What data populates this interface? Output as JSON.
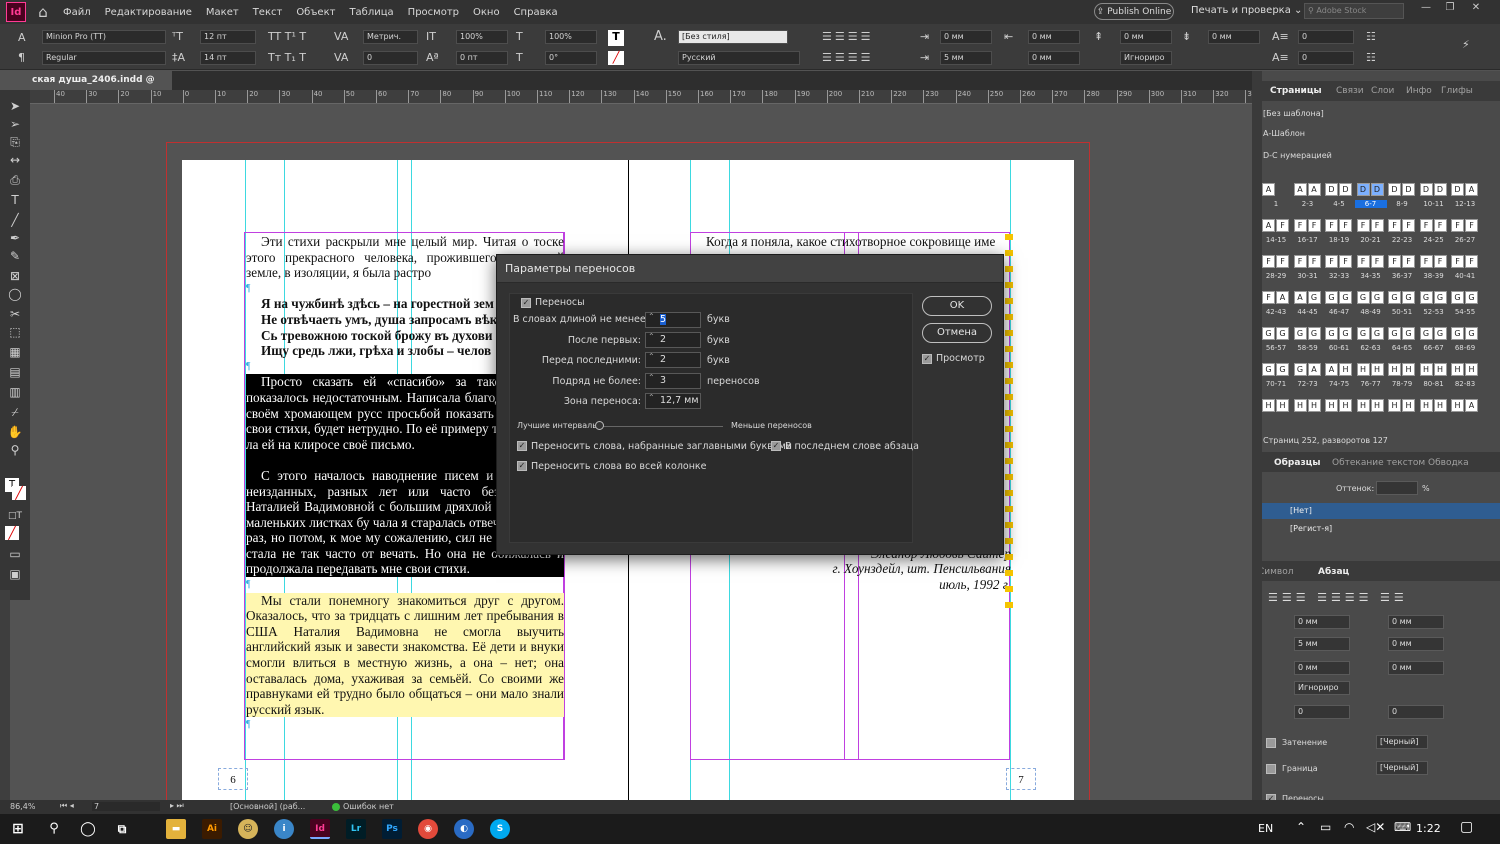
{
  "menubar": {
    "app_icon": "Id",
    "items": [
      "Файл",
      "Редактирование",
      "Макет",
      "Текст",
      "Объект",
      "Таблица",
      "Просмотр",
      "Окно",
      "Справка"
    ],
    "publish_label": "Publish Online",
    "print_review": "Печать и проверка",
    "stock_placeholder": "Adobe Stock"
  },
  "control": {
    "font_family": "Minion Pro (TT)",
    "font_style": "Regular",
    "size": "12 пт",
    "leading": "14 пт",
    "kerning": "Метрич.",
    "tracking": "0",
    "vscale": "100%",
    "hscale": "100%",
    "baseline": "0 пт",
    "skew": "0°",
    "char_style": "[Без стиля]",
    "language": "Русский",
    "indent_left": "0 мм",
    "indent_first": "5 мм",
    "indent_right": "0 мм",
    "indent_last": "0 мм",
    "space_before": "0 мм",
    "space_after": "0 мм",
    "drop_lines": "0",
    "drop_chars": "0",
    "grid_align": "Игнориро"
  },
  "doc_tab": {
    "title": "ская душа_2406.indd @ 86%"
  },
  "ruler_ticks": [
    "40",
    "30",
    "20",
    "10",
    "0",
    "10",
    "20",
    "30",
    "40",
    "50",
    "60",
    "70",
    "80",
    "90",
    "100",
    "110",
    "120",
    "130",
    "140",
    "150",
    "160",
    "170",
    "180",
    "190",
    "200",
    "210",
    "220",
    "230",
    "240",
    "250",
    "260",
    "270",
    "280",
    "290",
    "300",
    "310",
    "320",
    "330"
  ],
  "left_page": {
    "p1": "Эти стихи раскрыли мне целый мир. Читая о тоске этого прекрасного человека, прожившего на чужой земле, в изоляции, я была растро",
    "verse": [
      "Я на чужбинѣ здѣсь – на горестной зем",
      "Не отвѣчаеть умъ, душа запросамъ вѣк",
      "Сь тревожною тоской брожу въ духови",
      "Ищу средь лжи, грѣха и злобы – челов"
    ],
    "p2": "Просто сказать ей «спасибо» за такой по мне показалось недостаточным. Написала благодарности на своём хромающем русс просьбой показать мне другие свои стихи, будет нетрудно. По её примеру тихо и незам ла ей на клиросе своё письмо.",
    "p3": "С этого началось наводнение писем и сти ных и неизданных, разных лет или часто без чатанных Наталией Вадимовной с большим дряхлой машинке на маленьких листках бу чала я старалась отвечать каждый раз, но потом, к мое му сожалению, сил не хватало, и я стала не так часто от вечать. Но она не обижалась и продолжала передавать мне свои стихи.",
    "p4": "Мы стали понемногу знакомиться друг с другом. Оказалось, что за тридцать с лишним лет пребывания в США Наталия Вадимовна не смогла выучить английский язык и завести знакомства. Её дети и внуки смогли влиться в местную жизнь, а она – нет; она оставалась дома, ухаживая за семьёй. Со своими же правнуками ей трудно было общаться – они мало знали русский язык.",
    "folio": "6"
  },
  "right_page": {
    "p1": "Когда я поняла, какое стихотворное сокровище име",
    "sig": [
      "Элеанор Любовь Сайтер",
      "г. Хоунздейл, шт. Пенсильвания",
      "июль, 1992 г."
    ],
    "folio": "7"
  },
  "dialog": {
    "title": "Параметры переносов",
    "hyphenate": "Переносы",
    "words_min_label": "В словах длиной не менее:",
    "words_min": "5",
    "unit_letters": "букв",
    "after_first_label": "После первых:",
    "after_first": "2",
    "before_last_label": "Перед последними:",
    "before_last": "2",
    "limit_label": "Подряд не более:",
    "limit": "3",
    "limit_unit": "переносов",
    "zone_label": "Зона переноса:",
    "zone": "12,7 мм",
    "slider_left": "Лучшие интервалы",
    "slider_right": "Меньше переносов",
    "slider_value": 0.0,
    "caps": "Переносить слова, набранные заглавными буквами",
    "last_word": "В последнем слове абзаца",
    "across_column": "Переносить слова во всей колонке",
    "ok": "OK",
    "cancel": "Отмена",
    "preview": "Просмотр"
  },
  "panel": {
    "tabs": [
      "Страницы",
      "Связи",
      "Слои",
      "Инфо",
      "Глифы"
    ],
    "masters": [
      "[Без шаблона]",
      "А-Шаблон",
      "D-С нумерацией"
    ],
    "thumbs": [
      {
        "l": "A",
        "r": "",
        "n": "1"
      },
      {
        "l": "A",
        "r": "A",
        "n": "2-3"
      },
      {
        "l": "D",
        "r": "D",
        "n": "4-5"
      },
      {
        "l": "D",
        "r": "D",
        "n": "6-7",
        "sel": true
      },
      {
        "l": "D",
        "r": "D",
        "n": "8-9"
      },
      {
        "l": "D",
        "r": "D",
        "n": "10-11"
      },
      {
        "l": "D",
        "r": "A",
        "n": "12-13"
      },
      {
        "l": "A",
        "r": "F",
        "n": "14-15"
      },
      {
        "l": "F",
        "r": "F",
        "n": "16-17"
      },
      {
        "l": "F",
        "r": "F",
        "n": "18-19"
      },
      {
        "l": "F",
        "r": "F",
        "n": "20-21"
      },
      {
        "l": "F",
        "r": "F",
        "n": "22-23"
      },
      {
        "l": "F",
        "r": "F",
        "n": "24-25"
      },
      {
        "l": "F",
        "r": "F",
        "n": "26-27"
      },
      {
        "l": "F",
        "r": "F",
        "n": "28-29"
      },
      {
        "l": "F",
        "r": "F",
        "n": "30-31"
      },
      {
        "l": "F",
        "r": "F",
        "n": "32-33"
      },
      {
        "l": "F",
        "r": "F",
        "n": "34-35"
      },
      {
        "l": "F",
        "r": "F",
        "n": "36-37"
      },
      {
        "l": "F",
        "r": "F",
        "n": "38-39"
      },
      {
        "l": "F",
        "r": "F",
        "n": "40-41"
      },
      {
        "l": "F",
        "r": "A",
        "n": "42-43"
      },
      {
        "l": "A",
        "r": "G",
        "n": "44-45"
      },
      {
        "l": "G",
        "r": "G",
        "n": "46-47"
      },
      {
        "l": "G",
        "r": "G",
        "n": "48-49"
      },
      {
        "l": "G",
        "r": "G",
        "n": "50-51"
      },
      {
        "l": "G",
        "r": "G",
        "n": "52-53"
      },
      {
        "l": "G",
        "r": "G",
        "n": "54-55"
      },
      {
        "l": "G",
        "r": "G",
        "n": "56-57"
      },
      {
        "l": "G",
        "r": "G",
        "n": "58-59"
      },
      {
        "l": "G",
        "r": "G",
        "n": "60-61"
      },
      {
        "l": "G",
        "r": "G",
        "n": "62-63"
      },
      {
        "l": "G",
        "r": "G",
        "n": "64-65"
      },
      {
        "l": "G",
        "r": "G",
        "n": "66-67"
      },
      {
        "l": "G",
        "r": "G",
        "n": "68-69"
      },
      {
        "l": "G",
        "r": "G",
        "n": "70-71"
      },
      {
        "l": "G",
        "r": "A",
        "n": "72-73"
      },
      {
        "l": "A",
        "r": "H",
        "n": "74-75"
      },
      {
        "l": "H",
        "r": "H",
        "n": "76-77"
      },
      {
        "l": "H",
        "r": "H",
        "n": "78-79"
      },
      {
        "l": "H",
        "r": "H",
        "n": "80-81"
      },
      {
        "l": "H",
        "r": "H",
        "n": "82-83"
      },
      {
        "l": "H",
        "r": "H",
        "n": ""
      },
      {
        "l": "H",
        "r": "H",
        "n": ""
      },
      {
        "l": "H",
        "r": "H",
        "n": ""
      },
      {
        "l": "H",
        "r": "H",
        "n": ""
      },
      {
        "l": "H",
        "r": "H",
        "n": ""
      },
      {
        "l": "H",
        "r": "H",
        "n": ""
      },
      {
        "l": "H",
        "r": "A",
        "n": ""
      }
    ],
    "pages_status": "Страниц 252, разворотов 127",
    "swatch_tabs": [
      "Образцы",
      "Обтекание текстом",
      "Обводка"
    ],
    "tint_label": "Оттенок:",
    "tint_unit": "%",
    "swatches": [
      "[Нет]",
      "[Регист-я]"
    ],
    "para_tabs": [
      "Символ",
      "Абзац"
    ],
    "para_fields": [
      "0 мм",
      "0 мм",
      "5 мм",
      "0 мм",
      "0 мм",
      "0 мм",
      "Игнориро",
      "0",
      "0"
    ],
    "shading": "Затенение",
    "border": "Граница",
    "black": "[Черный]",
    "hyph": "Переносы"
  },
  "status": {
    "zoom": "86,4%",
    "page": "7",
    "base": "[Основной] (раб...",
    "errors": "Ошибок нет"
  },
  "taskbar": {
    "lang": "EN",
    "time": "1:22"
  }
}
